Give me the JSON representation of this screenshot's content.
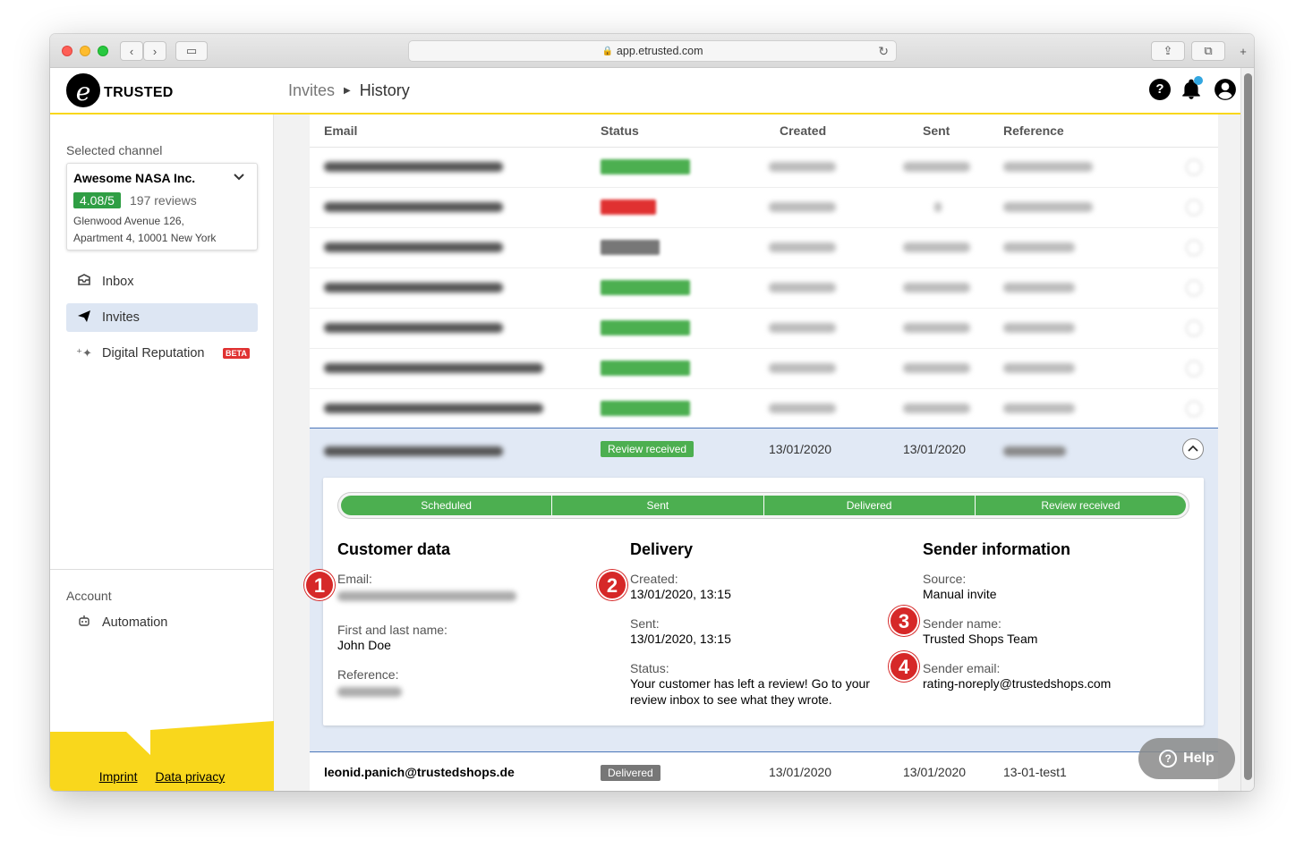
{
  "browser": {
    "url": "app.etrusted.com"
  },
  "header": {
    "logo_letter": "e",
    "logo_text": "TRUSTED",
    "breadcrumb": [
      "Invites",
      "History"
    ],
    "help_icon": "?",
    "bell_icon": "bell-icon",
    "user_icon": "user-icon"
  },
  "sidebar": {
    "selected_channel_label": "Selected channel",
    "channel": {
      "name": "Awesome NASA Inc.",
      "score": "4.08/5",
      "reviews": "197 reviews",
      "address_line1": "Glenwood Avenue 126,",
      "address_line2": "Apartment 4, 10001 New York"
    },
    "nav": [
      {
        "label": "Inbox",
        "icon": "inbox-icon"
      },
      {
        "label": "Invites",
        "icon": "paper-plane-icon",
        "active": true
      },
      {
        "label": "Digital Reputation",
        "icon": "sparkle-icon",
        "badge": "BETA"
      }
    ],
    "account_label": "Account",
    "account_items": [
      {
        "label": "Automation",
        "icon": "robot-icon"
      }
    ],
    "footer_links": [
      "Imprint",
      "Data privacy"
    ],
    "footer_color": "#f9d71c"
  },
  "table": {
    "headers": [
      "Email",
      "Status",
      "Created",
      "Sent",
      "Reference"
    ],
    "blurred_row_status_colors": [
      "#4caf50",
      "#e03131",
      "#777777",
      "#4caf50",
      "#4caf50",
      "#4caf50",
      "#4caf50"
    ],
    "expanded_row": {
      "status": "Review received",
      "created": "13/01/2020",
      "sent": "13/01/2020",
      "steps": [
        "Scheduled",
        "Sent",
        "Delivered",
        "Review received"
      ],
      "customer_data": {
        "title": "Customer data",
        "email_label": "Email:",
        "name_label": "First and last name:",
        "name_value": "John Doe",
        "reference_label": "Reference:"
      },
      "delivery": {
        "title": "Delivery",
        "created_label": "Created:",
        "created_value": "13/01/2020, 13:15",
        "sent_label": "Sent:",
        "sent_value": "13/01/2020, 13:15",
        "status_label": "Status:",
        "status_value_line1": "Your customer has left a review! Go to your",
        "status_value_line2": "review inbox to see what they wrote."
      },
      "sender": {
        "title": "Sender information",
        "source_label": "Source:",
        "source_value": "Manual invite",
        "sender_name_label": "Sender name:",
        "sender_name_value": "Trusted Shops Team",
        "sender_email_label": "Sender email:",
        "sender_email_value": "rating-noreply@trustedshops.com"
      },
      "markers": [
        "1",
        "2",
        "3",
        "4"
      ]
    },
    "last_row": {
      "email": "leonid.panich@trustedshops.de",
      "status": "Delivered",
      "created": "13/01/2020",
      "sent": "13/01/2020",
      "reference": "13-01-test1"
    }
  },
  "help_button": "Help",
  "colors": {
    "accent_yellow": "#f9d71c",
    "success_green": "#4caf50",
    "marker_red": "#d62828",
    "selected_blue": "#dde6f3"
  }
}
